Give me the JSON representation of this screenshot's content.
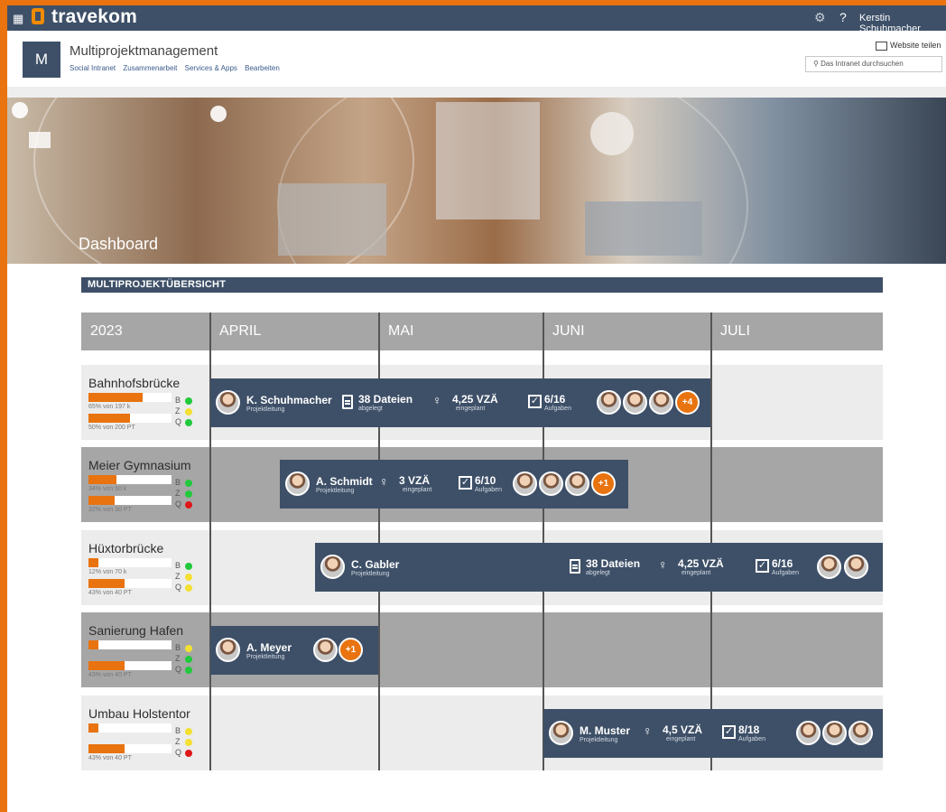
{
  "suitebar": {
    "brand": "travekom",
    "user_name": "Kerstin Schuhmacher",
    "help": "?"
  },
  "site": {
    "logo_letter": "M",
    "title": "Multiprojektmanagement",
    "nav": [
      "Social Intranet",
      "Zusammenarbeit",
      "Services & Apps",
      "Bearbeiten"
    ],
    "share_label": "Website teilen",
    "search_placeholder": "Das Intranet durchsuchen"
  },
  "hero": {
    "title": "Dashboard"
  },
  "section": {
    "title": "MULTIPROJEKTÜBERSICHT"
  },
  "timeline": {
    "year": "2023",
    "months": [
      "APRIL",
      "MAI",
      "JUNI",
      "JULI"
    ],
    "projects": [
      {
        "name": "Bahnhofsbrücke",
        "budget_pct": 65,
        "budget_label": "65% von 197 k",
        "time_pct": 50,
        "time_label": "50% von 200 PT",
        "lights": [
          {
            "letter": "B",
            "color": "#22c93c"
          },
          {
            "letter": "Z",
            "color": "#f4e032"
          },
          {
            "letter": "Q",
            "color": "#22c93c"
          }
        ],
        "lead": "K. Schuhmacher",
        "lead_role": "Projektleitung",
        "files": "38 Dateien",
        "files_sub": "abgelegt",
        "vza": "4,25 VZÄ",
        "vza_sub": "eingeplant",
        "tasks": "6/16",
        "tasks_sub": "Aufgaben",
        "extra": "+4"
      },
      {
        "name": "Meier Gymnasium",
        "budget_pct": 34,
        "budget_label": "34% von 50 k",
        "time_pct": 32,
        "time_label": "32% von 30 PT",
        "lights": [
          {
            "letter": "B",
            "color": "#22c93c"
          },
          {
            "letter": "Z",
            "color": "#22c93c"
          },
          {
            "letter": "Q",
            "color": "#e01818"
          }
        ],
        "lead": "A. Schmidt",
        "lead_role": "Projektleitung",
        "vza": "3 VZÄ",
        "vza_sub": "eingeplant",
        "tasks": "6/10",
        "tasks_sub": "Aufgaben",
        "extra": "+1"
      },
      {
        "name": "Hüxtorbrücke",
        "budget_pct": 12,
        "budget_label": "12% von 70 k",
        "time_pct": 43,
        "time_label": "43% von 40 PT",
        "lights": [
          {
            "letter": "B",
            "color": "#22c93c"
          },
          {
            "letter": "Z",
            "color": "#f4e032"
          },
          {
            "letter": "Q",
            "color": "#f4e032"
          }
        ],
        "lead": "C. Gabler",
        "lead_role": "Projektleitung",
        "files": "38 Dateien",
        "files_sub": "abgelegt",
        "vza": "4,25 VZÄ",
        "vza_sub": "eingeplant",
        "tasks": "6/16",
        "tasks_sub": "Aufgaben"
      },
      {
        "name": "Sanierung Hafen",
        "budget_pct": 12,
        "time_pct": 43,
        "time_label": "43% von 40 PT",
        "lights": [
          {
            "letter": "B",
            "color": "#f4e032"
          },
          {
            "letter": "Z",
            "color": "#22c93c"
          },
          {
            "letter": "Q",
            "color": "#22c93c"
          }
        ],
        "lead": "A. Meyer",
        "lead_role": "Projektleitung",
        "extra": "+1"
      },
      {
        "name": "Umbau Holstentor",
        "budget_pct": 12,
        "time_pct": 43,
        "time_label": "43% von 40 PT",
        "lights": [
          {
            "letter": "B",
            "color": "#f4e032"
          },
          {
            "letter": "Z",
            "color": "#f4e032"
          },
          {
            "letter": "Q",
            "color": "#e01818"
          }
        ],
        "lead": "M. Muster",
        "lead_role": "Projektleitung",
        "vza": "4,5 VZÄ",
        "vza_sub": "eingeplant",
        "tasks": "8/18",
        "tasks_sub": "Aufgaben"
      }
    ]
  },
  "icons": [
    "waffle-icon",
    "gear-icon",
    "help-icon",
    "share-icon",
    "search-icon",
    "document-icon",
    "person-add-icon",
    "checkbox-icon"
  ]
}
